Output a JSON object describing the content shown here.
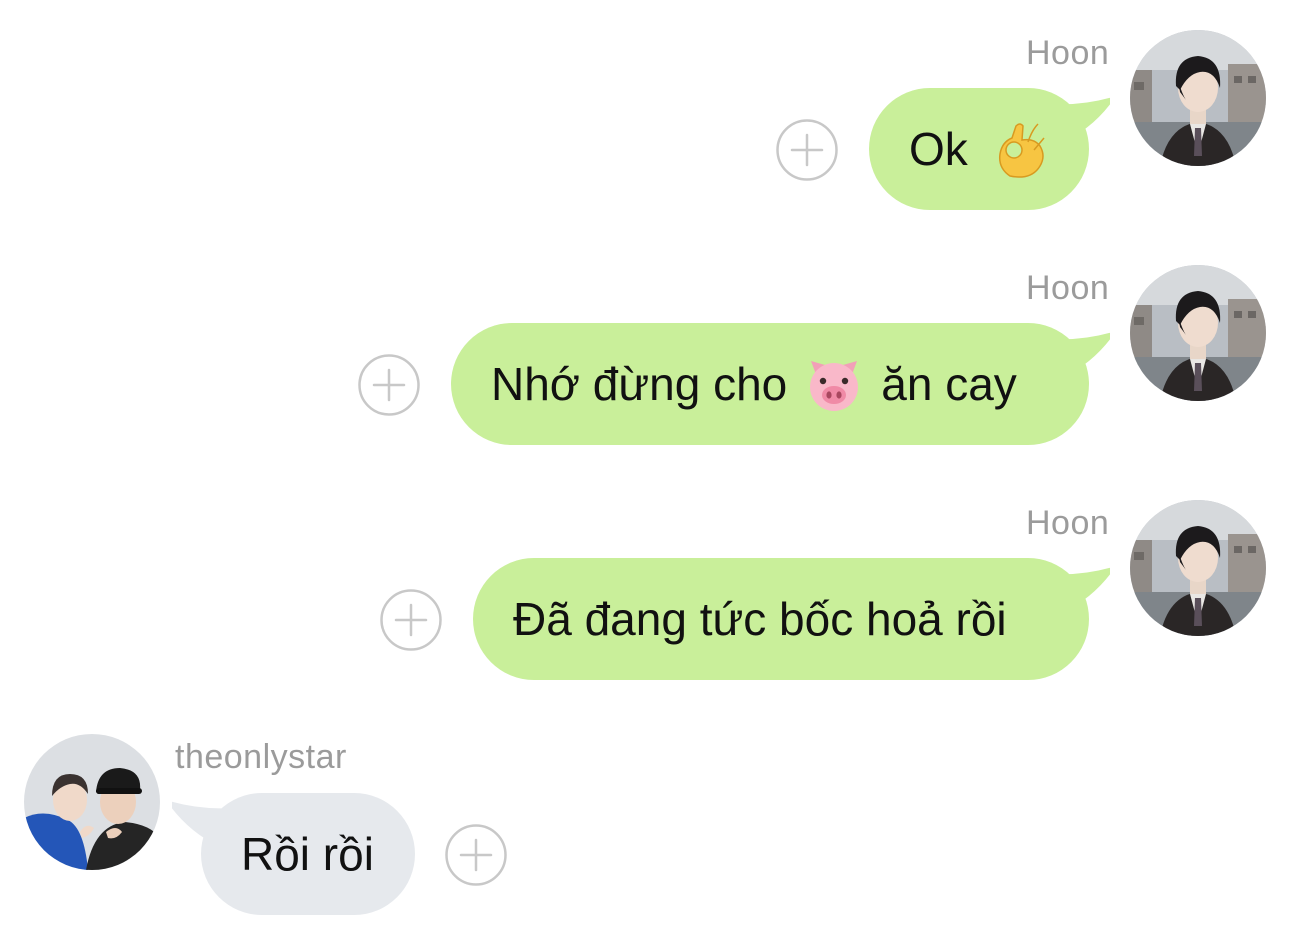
{
  "messages": [
    {
      "sender": "Hoon",
      "text": "Ok",
      "emoji": "ok-hand-emoji",
      "direction": "outgoing"
    },
    {
      "sender": "Hoon",
      "text_before": "Nhớ đừng cho",
      "emoji": "pig-face-emoji",
      "text_after": "ăn cay",
      "direction": "outgoing"
    },
    {
      "sender": "Hoon",
      "text": "Đã đang tức bốc hoả rồi",
      "direction": "outgoing"
    },
    {
      "sender": "theonlystar",
      "text": "Rồi rồi",
      "direction": "incoming"
    }
  ],
  "icons": {
    "reaction": "add-reaction-icon",
    "avatar_hoon": "hoon-avatar",
    "avatar_theonlystar": "theonlystar-avatar"
  },
  "colors": {
    "outgoing_bubble": "#c9ef9a",
    "incoming_bubble": "#e6e9ed",
    "sender_name": "#9b9b9b",
    "message_text": "#111111",
    "plus_icon": "#c8c8c8"
  }
}
